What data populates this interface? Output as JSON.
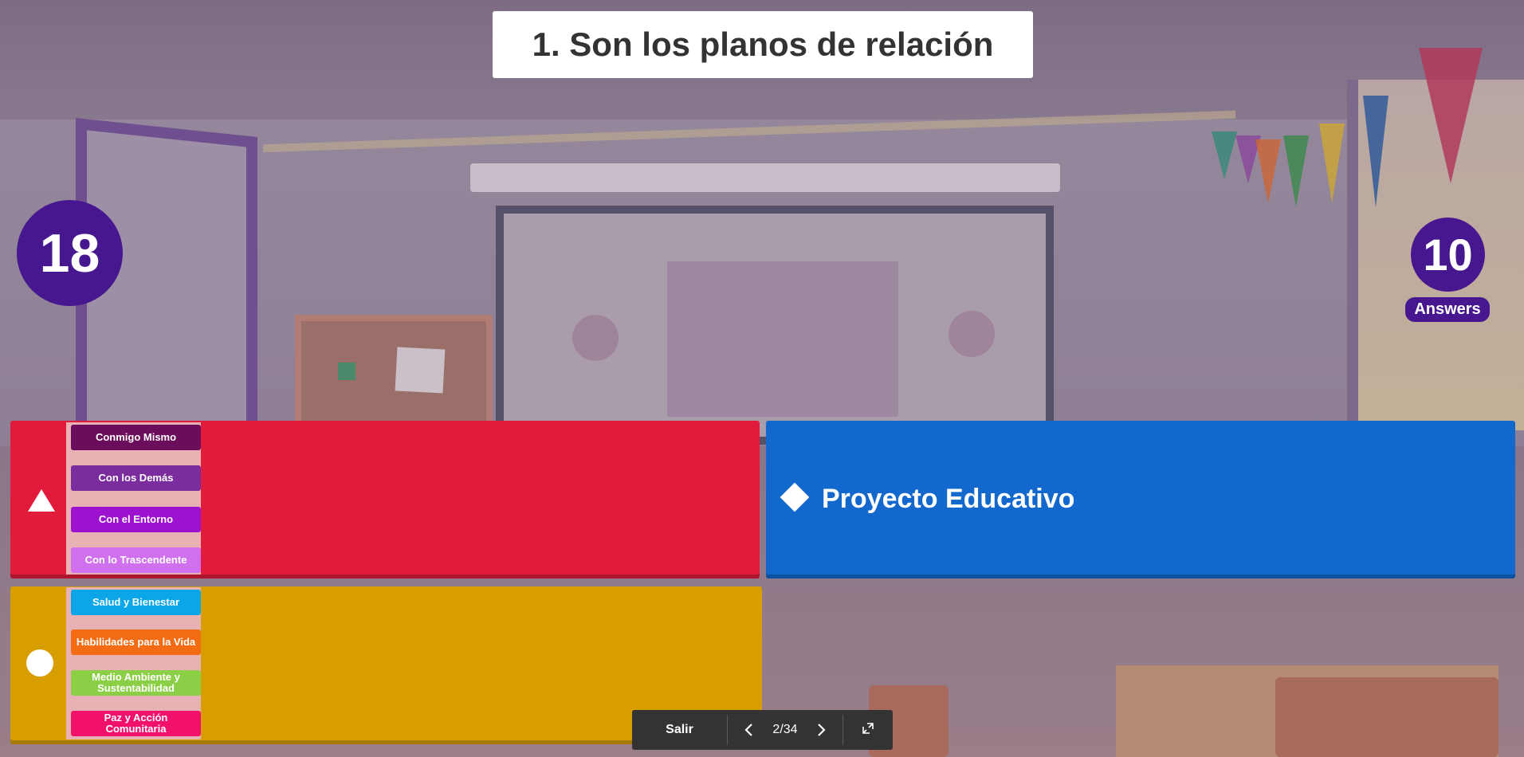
{
  "question": {
    "title": "1. Son los planos de relación"
  },
  "timer": {
    "value": "18"
  },
  "answers_counter": {
    "count": "10",
    "label": "Answers"
  },
  "options": {
    "red": {
      "shape": "triangle-icon",
      "color": "#e21b3c",
      "image_labels": [
        "Conmigo Mismo",
        "Con los Demás",
        "Con el Entorno",
        "Con lo Trascendente"
      ],
      "image_label_colors": [
        "#6b0d5a",
        "#7b2d9e",
        "#9c12cf",
        "#d070ef"
      ]
    },
    "blue": {
      "shape": "diamond-icon",
      "color": "#1368ce",
      "text": "Proyecto Educativo"
    },
    "yellow": {
      "shape": "circle-icon",
      "color": "#d89e00",
      "image_labels": [
        "Salud y Bienestar",
        "Habilidades para la Vida",
        "Medio Ambiente y Sustentabilidad",
        "Paz y Acción Comunitaria"
      ],
      "image_label_colors": [
        "#0aa6e8",
        "#f36c14",
        "#8bcf47",
        "#f2116a"
      ]
    }
  },
  "controls": {
    "exit_label": "Salir",
    "page": "2/34",
    "prev_icon": "chevron-left-icon",
    "next_icon": "chevron-right-icon",
    "fullscreen_icon": "fullscreen-icon"
  }
}
